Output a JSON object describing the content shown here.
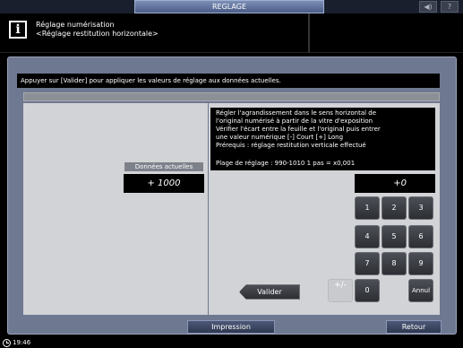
{
  "topbar": {
    "tab_label": "REGLAGE",
    "icons": [
      {
        "name": "sound-icon",
        "glyph": "◀)"
      },
      {
        "name": "help-icon",
        "glyph": "?"
      }
    ]
  },
  "header": {
    "title": "Réglage numérisation",
    "subtitle": "<Réglage restitution horizontale>"
  },
  "instruction": "Appuyer sur [Valider] pour appliquer les valeurs de réglage aux données actuelles.",
  "description": {
    "lines": [
      "Régler l'agrandissement dans le sens horizontal de",
      "l'original numérisé à partir de la vitre d'exposition",
      "Vérifier l'écart entre la feuille et l'original puis entrer",
      "une valeur numérique    [-] Court [+] Long",
      "Prérequis : réglage restitution verticale effectué"
    ],
    "range": "Plage de réglage : 990-1010 1 pas = x0,001"
  },
  "current": {
    "label": "Données actuelles",
    "value": "+ 1000"
  },
  "entry": {
    "value": "+0"
  },
  "keypad": {
    "keys": [
      "1",
      "2",
      "3",
      "4",
      "5",
      "6",
      "7",
      "8",
      "9",
      "+/-",
      "0",
      "Annul"
    ]
  },
  "buttons": {
    "valider": "Valider",
    "impression": "Impression",
    "retour": "Retour"
  },
  "status": {
    "time": "19:46"
  }
}
